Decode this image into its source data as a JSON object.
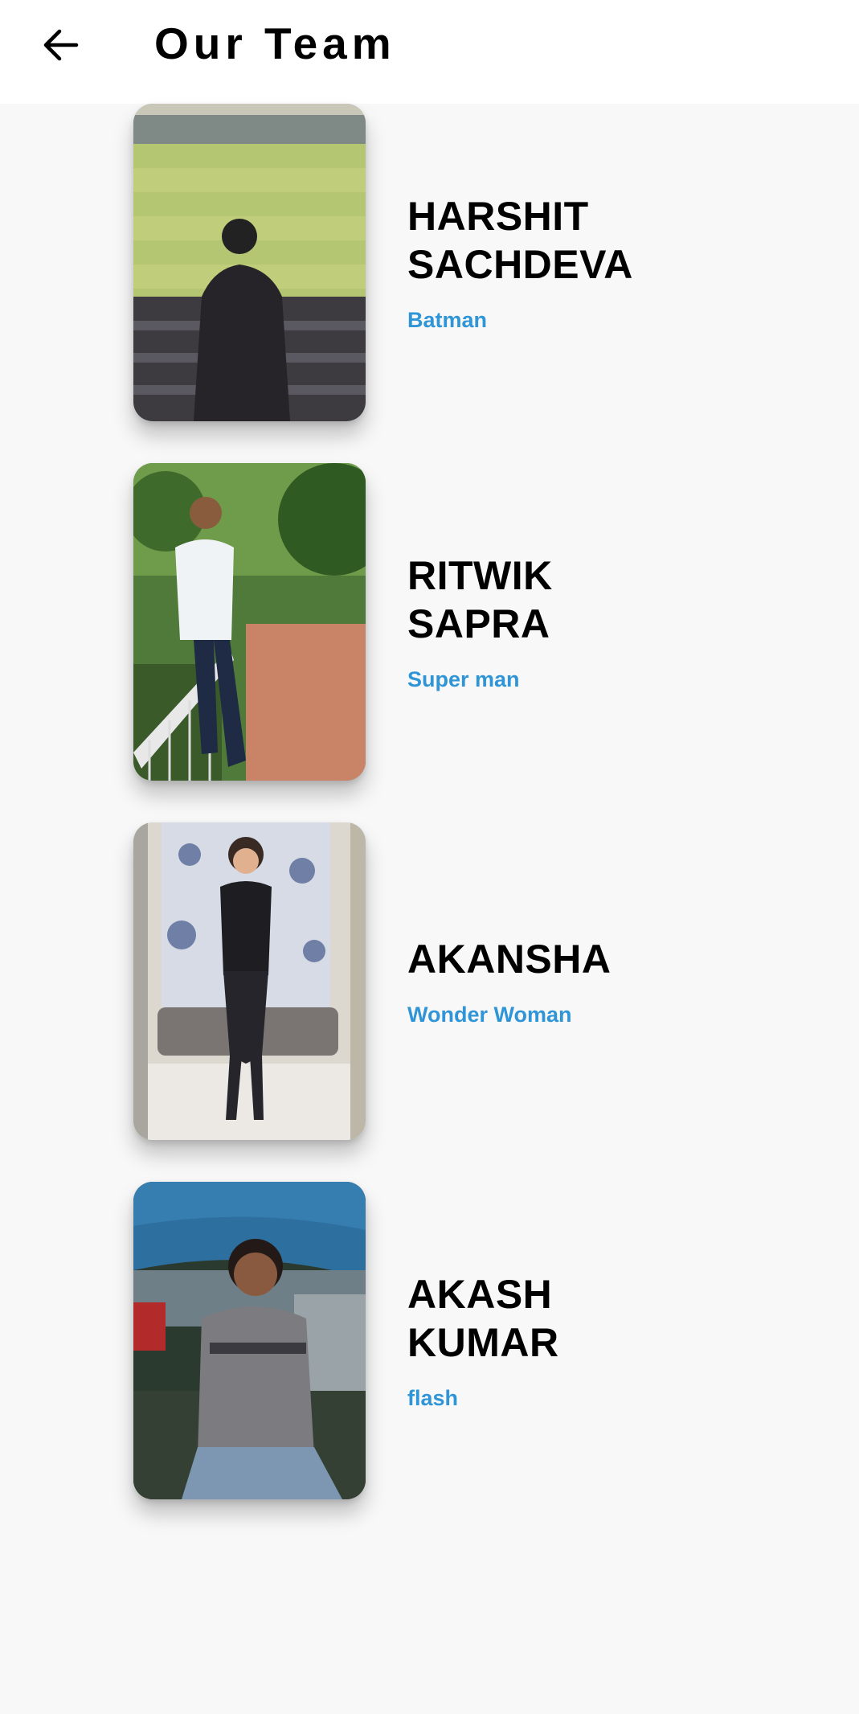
{
  "header": {
    "title": "Our Team",
    "back_icon": "arrow-left-icon"
  },
  "members": [
    {
      "name": "HARSHIT\nSACHDEVA",
      "role": "Batman",
      "photo_description_icon": "stadium-photo"
    },
    {
      "name": "RITWIK\nSAPRA",
      "role": "Super man",
      "photo_description_icon": "garden-photo"
    },
    {
      "name": "AKANSHA",
      "role": "Wonder Woman",
      "photo_description_icon": "armchair-photo"
    },
    {
      "name": "AKASH\nKUMAR",
      "role": "flash",
      "photo_description_icon": "tent-photo"
    }
  ],
  "colors": {
    "background": "#f8f8f8",
    "app_bar": "#ffffff",
    "role_accent": "#2f95d6",
    "name_text": "#000000"
  }
}
